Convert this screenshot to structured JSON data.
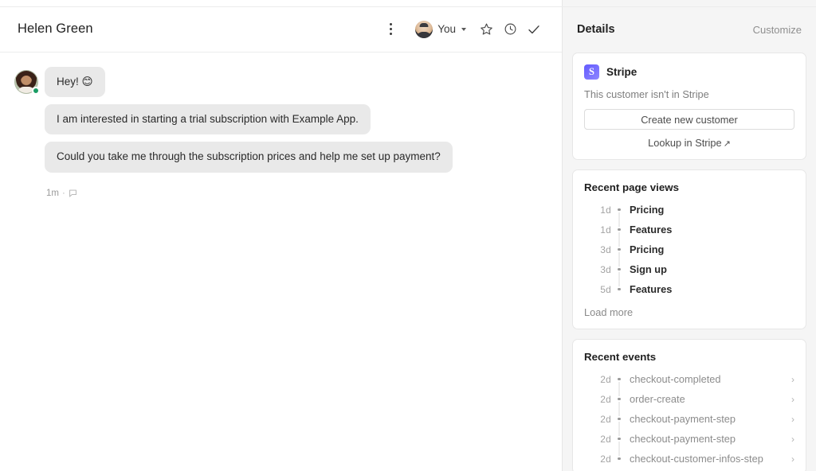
{
  "conversation": {
    "title": "Helen Green",
    "header_actions": {
      "more_label": "More options",
      "assignee_name": "You",
      "star_label": "Star",
      "snooze_label": "Snooze",
      "close_label": "Close conversation"
    },
    "messages": [
      {
        "author": "Helen Green",
        "presence": "online",
        "bubbles": [
          "Hey! 😊",
          "I am interested in starting a trial subscription with Example App.",
          "Could you take me through the subscription prices and help me set up payment?"
        ],
        "time": "1m",
        "separator": "·"
      }
    ]
  },
  "details": {
    "title": "Details",
    "customize_label": "Customize",
    "stripe": {
      "app_name": "Stripe",
      "logo_letter": "S",
      "note": "This customer isn't in Stripe",
      "create_button": "Create new customer",
      "lookup_link": "Lookup in Stripe",
      "lookup_arrow": "↗",
      "brand_color": "#635bff"
    },
    "page_views": {
      "title": "Recent page views",
      "items": [
        {
          "age": "1d",
          "label": "Pricing"
        },
        {
          "age": "1d",
          "label": "Features"
        },
        {
          "age": "3d",
          "label": "Pricing"
        },
        {
          "age": "3d",
          "label": "Sign up"
        },
        {
          "age": "5d",
          "label": "Features"
        }
      ],
      "load_more": "Load more"
    },
    "events": {
      "title": "Recent events",
      "items": [
        {
          "age": "2d",
          "label": "checkout-completed",
          "chevron": "›"
        },
        {
          "age": "2d",
          "label": "order-create",
          "chevron": "›"
        },
        {
          "age": "2d",
          "label": "checkout-payment-step",
          "chevron": "›"
        },
        {
          "age": "2d",
          "label": "checkout-payment-step",
          "chevron": "›"
        },
        {
          "age": "2d",
          "label": "checkout-customer-infos-step",
          "chevron": "›"
        }
      ]
    }
  }
}
